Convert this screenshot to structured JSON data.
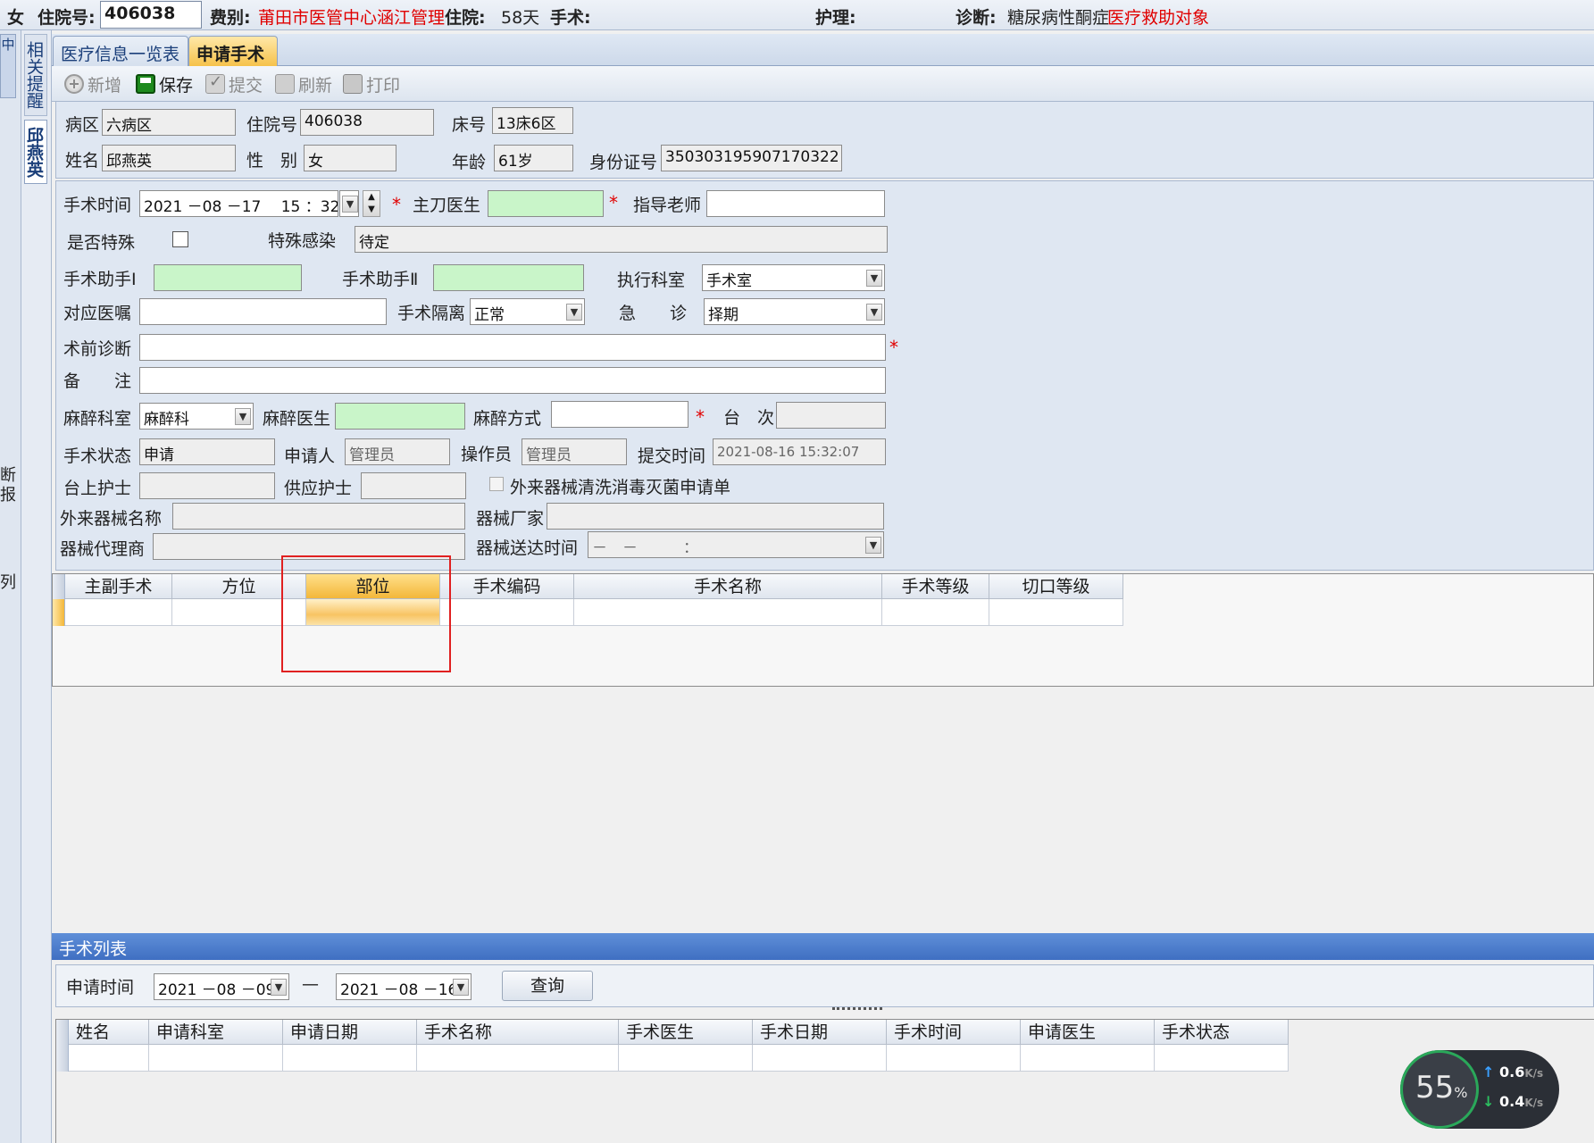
{
  "topbar": {
    "sex_value": "女",
    "admission_label": "住院号:",
    "admission_value": "406038",
    "fee_label": "费别:",
    "fee_value": "莆田市医管中心涵江管理部",
    "stay_label": "住院:",
    "stay_value": "58天",
    "surgery_label": "手术:",
    "nursing_label": "护理:",
    "diagnosis_label": "诊断:",
    "diagnosis_value": "糖尿病性酮症",
    "diagnosis_flag": "医疗救助对象"
  },
  "left": {
    "collapsed_tab": "中",
    "vtab_reminder": "相关提醒",
    "vtab_patient": "邱燕英",
    "frag1": "断",
    "frag2": "报",
    "frag3": "列"
  },
  "tabs": [
    {
      "label": "医疗信息一览表",
      "active": false
    },
    {
      "label": "申请手术",
      "active": true
    }
  ],
  "toolbar": {
    "new_label": "新增",
    "save_label": "保存",
    "submit_label": "提交",
    "refresh_label": "刷新",
    "print_label": "打印"
  },
  "patient": {
    "ward_label": "病区",
    "ward_value": "六病区",
    "admission_label": "住院号",
    "admission_value": "406038",
    "bed_label": "床号",
    "bed_value": "13床6区",
    "name_label": "姓名",
    "name_value": "邱燕英",
    "sex_label": "性　别",
    "sex_value": "女",
    "age_label": "年龄",
    "age_value": "61岁",
    "id_label": "身份证号",
    "id_value": "350303195907170322"
  },
  "form": {
    "time_label": "手术时间",
    "time_value": "2021 －08 －17　 15 ：32",
    "surgeon_label": "主刀医生",
    "mentor_label": "指导老师",
    "special_label": "是否特殊",
    "infection_label": "特殊感染",
    "infection_value": "待定",
    "assistant1_label": "手术助手Ⅰ",
    "assistant2_label": "手术助手Ⅱ",
    "dept_label": "执行科室",
    "dept_value": "手术室",
    "order_label": "对应医嘱",
    "isolation_label": "手术隔离",
    "isolation_value": "正常",
    "urgent_label": "急　　诊",
    "urgent_value": "择期",
    "prediag_label": "术前诊断",
    "remark_label": "备　　注",
    "anes_dept_label": "麻醉科室",
    "anes_dept_value": "麻醉科",
    "anes_doctor_label": "麻醉医生",
    "anes_method_label": "麻醉方式",
    "table_label": "台　次",
    "status_label": "手术状态",
    "status_value": "申请",
    "applicant_label": "申请人",
    "applicant_value": "管理员",
    "operator_label": "操作员",
    "operator_value": "管理员",
    "submit_time_label": "提交时间",
    "submit_time_value": "2021-08-16 15:32:07",
    "table_nurse_label": "台上护士",
    "supply_nurse_label": "供应护士",
    "external_check_label": "外来器械清洗消毒灭菌申请单",
    "device_name_label": "外来器械名称",
    "manufacturer_label": "器械厂家",
    "agent_label": "器械代理商",
    "delivery_time_label": "器械送达时间",
    "delivery_time_value": "－　－　　　：",
    "required_mark": "*"
  },
  "surgery_grid": {
    "columns": [
      "主副手术",
      "方位",
      "部位",
      "手术编码",
      "手术名称",
      "手术等级",
      "切口等级"
    ]
  },
  "op_list": {
    "title": "手术列表",
    "query_label": "申请时间",
    "from_value": "2021 －08 －09",
    "dash": "—",
    "to_value": "2021 －08 －16",
    "query_button": "查询",
    "columns": [
      "姓名",
      "申请科室",
      "申请日期",
      "手术名称",
      "手术医生",
      "手术日期",
      "手术时间",
      "申请医生",
      "手术状态"
    ]
  },
  "net": {
    "percent": "55",
    "percent_unit": "%",
    "up": "0.6",
    "down": "0.4",
    "unit": "K/s"
  }
}
